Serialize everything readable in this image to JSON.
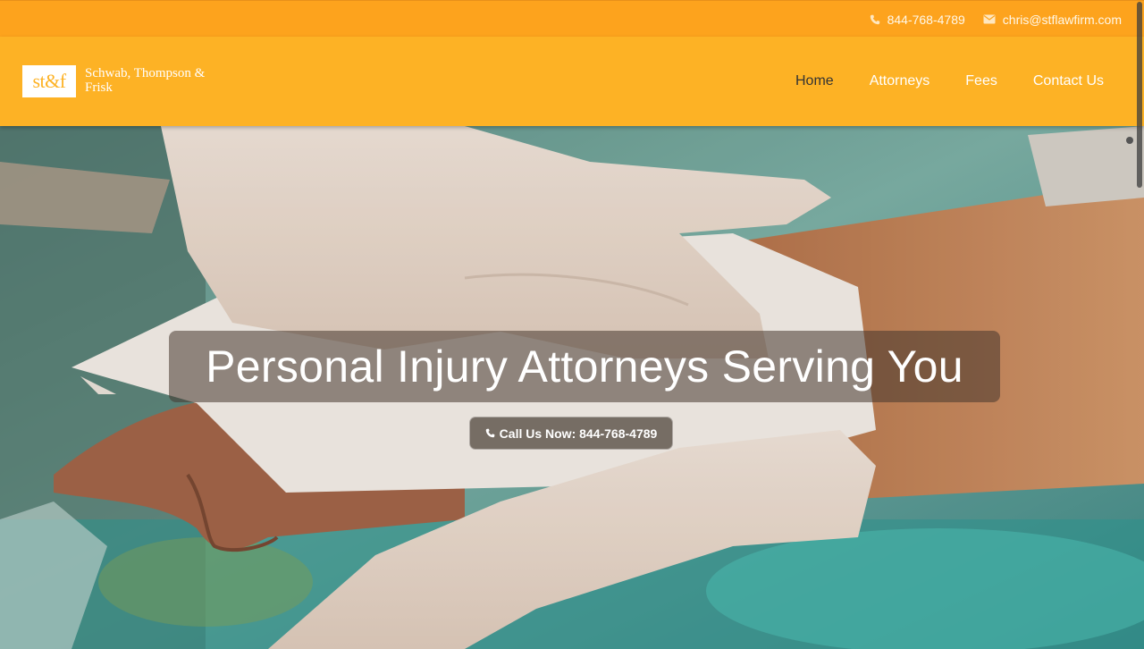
{
  "topbar": {
    "phone": "844-768-4789",
    "email": "chris@stflawfirm.com",
    "phone_icon": "phone-icon",
    "email_icon": "envelope-icon"
  },
  "logo": {
    "mark": "st&f",
    "name": "Schwab, Thompson & Frisk"
  },
  "nav": {
    "items": [
      {
        "label": "Home",
        "active": true
      },
      {
        "label": "Attorneys"
      },
      {
        "label": "Fees"
      },
      {
        "label": "Contact Us"
      }
    ]
  },
  "hero": {
    "headline": "Personal Injury Attorneys Serving You",
    "cta_label": "Call Us Now: 844-768-4789",
    "cta_icon": "phone-icon"
  },
  "colors": {
    "topbar": "#fda31d",
    "navbar": "#fdb225",
    "active_nav": "#333333"
  }
}
